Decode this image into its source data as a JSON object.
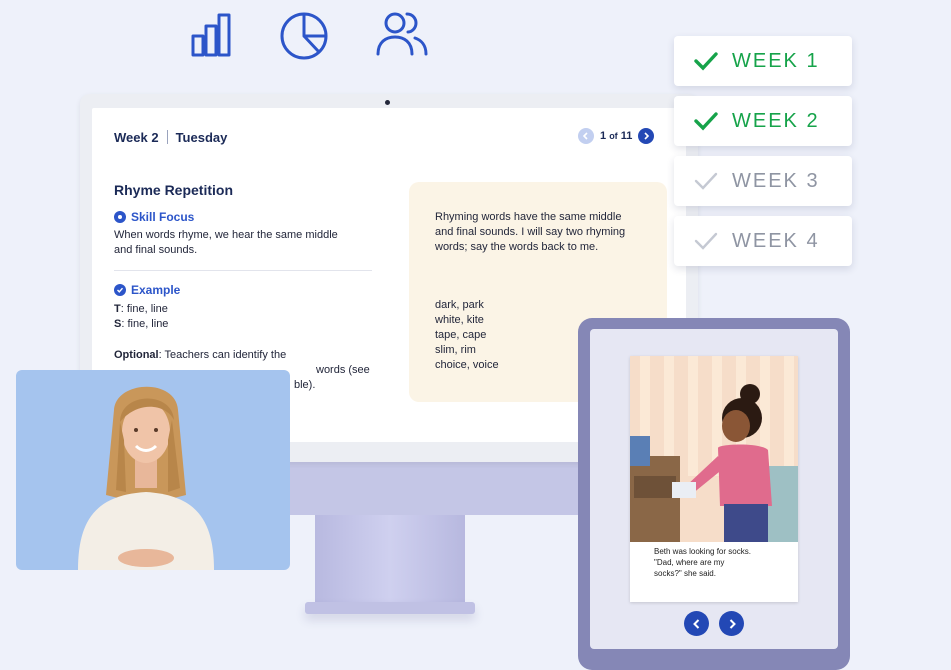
{
  "monitor": {
    "header": {
      "week": "Week 2",
      "day": "Tuesday"
    },
    "pager": {
      "current": "1",
      "of_word": "of",
      "total": "11"
    },
    "lesson": {
      "title": "Rhyme Repetition",
      "skill_focus_label": "Skill Focus",
      "skill_focus_text": "When words rhyme, we hear the same middle and final sounds.",
      "example_label": "Example",
      "example_lines": [
        {
          "speaker": "T",
          "text": ": fine, line"
        },
        {
          "speaker": "S",
          "text": ": fine, line"
        }
      ],
      "optional_label": "Optional",
      "optional_visible": [
        ": Teachers can identify the",
        "words (see",
        "ble)."
      ]
    },
    "note_card": {
      "intro": "Rhyming words have the same middle and final sounds. I will say two rhyming words; say the words back to me.",
      "pairs": [
        "dark, park",
        "white, kite",
        "tape, cape",
        "slim, rim",
        "choice, voice"
      ]
    }
  },
  "weeks": [
    {
      "label": "WEEK 1",
      "completed": true
    },
    {
      "label": "WEEK 2",
      "completed": true
    },
    {
      "label": "WEEK 3",
      "completed": false
    },
    {
      "label": "WEEK 4",
      "completed": false
    }
  ],
  "tablet": {
    "caption_lines": [
      "Beth was looking for socks.",
      "\"Dad, where are my",
      "socks?\" she said."
    ]
  },
  "icons": [
    "bar-chart-icon",
    "pie-chart-icon",
    "users-icon",
    "check-icon",
    "chevron-left-icon",
    "chevron-right-icon"
  ],
  "colors": {
    "accent": "#2c55c9",
    "completed_green": "#16a34a",
    "pending_gray": "#9aa0ae",
    "note_bg": "#fbf4e6",
    "video_bg": "#a5c4ee",
    "tablet_frame": "#8587b6"
  }
}
